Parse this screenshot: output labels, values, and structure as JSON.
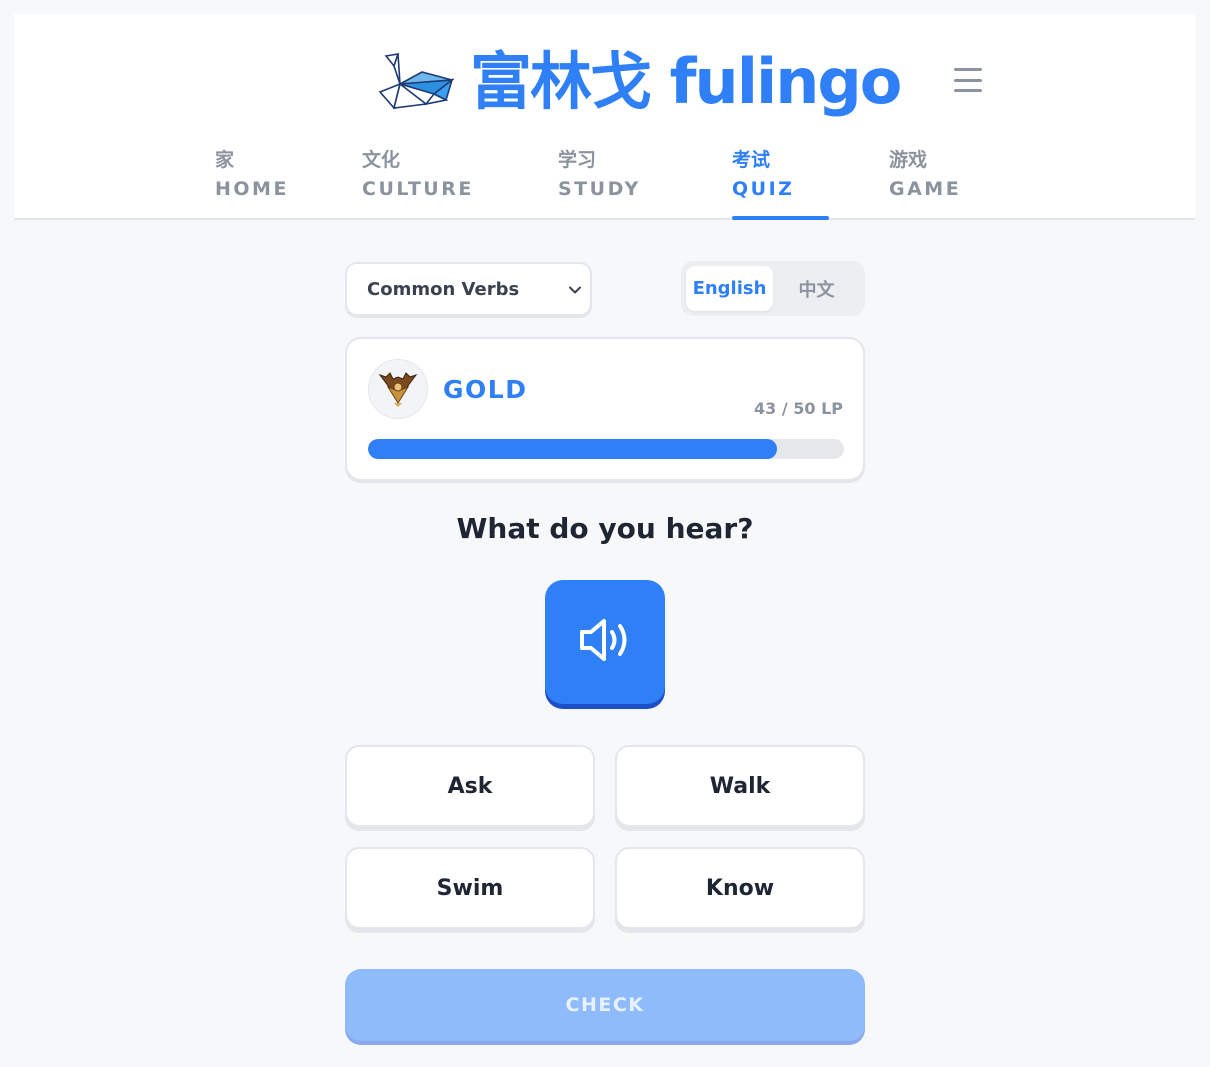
{
  "brand": {
    "name": "富林戈 fulingo",
    "logo_icon": "origami-swan-icon",
    "menu_icon": "hamburger-menu-icon"
  },
  "nav": {
    "items": [
      {
        "cn": "家",
        "en": "HOME"
      },
      {
        "cn": "文化",
        "en": "CULTURE"
      },
      {
        "cn": "学习",
        "en": "STUDY"
      },
      {
        "cn": "考试",
        "en": "QUIZ"
      },
      {
        "cn": "游戏",
        "en": "GAME"
      }
    ],
    "active": "QUIZ"
  },
  "category_select": {
    "value": "Common Verbs",
    "icon": "chevron-down-icon"
  },
  "language_toggle": {
    "options": [
      "English",
      "中文"
    ],
    "selected": "English"
  },
  "rank": {
    "tier": "GOLD",
    "badge_icon": "gold-eagle-rank-icon",
    "lp_text": "43 / 50 LP",
    "lp_current": 43,
    "lp_max": 50
  },
  "question": {
    "prompt": "What do you hear?",
    "audio_icon": "speaker-icon"
  },
  "options": [
    "Ask",
    "Walk",
    "Swim",
    "Know"
  ],
  "check_button": {
    "label": "CHECK",
    "state": "disabled"
  },
  "colors": {
    "accent": "#2f7ff7",
    "gold": "#b07a2a",
    "muted": "#8b939e"
  }
}
